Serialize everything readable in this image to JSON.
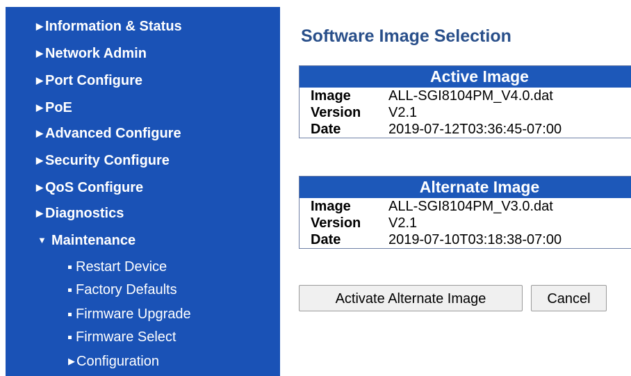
{
  "sidebar": {
    "items": [
      {
        "label": "Information & Status"
      },
      {
        "label": "Network Admin"
      },
      {
        "label": "Port Configure"
      },
      {
        "label": "PoE"
      },
      {
        "label": "Advanced Configure"
      },
      {
        "label": "Security Configure"
      },
      {
        "label": "QoS Configure"
      },
      {
        "label": "Diagnostics"
      },
      {
        "label": "Maintenance",
        "expanded": true
      }
    ],
    "maintenance_children": [
      {
        "label": "Restart Device"
      },
      {
        "label": "Factory Defaults"
      },
      {
        "label": "Firmware Upgrade"
      },
      {
        "label": "Firmware Select"
      },
      {
        "label": "Configuration"
      }
    ]
  },
  "main": {
    "title": "Software Image Selection",
    "active": {
      "heading": "Active Image",
      "image_label": "Image",
      "image_value": "ALL-SGI8104PM_V4.0.dat",
      "version_label": "Version",
      "version_value": "V2.1",
      "date_label": "Date",
      "date_value": "2019-07-12T03:36:45-07:00"
    },
    "alternate": {
      "heading": "Alternate Image",
      "image_label": "Image",
      "image_value": "ALL-SGI8104PM_V3.0.dat",
      "version_label": "Version",
      "version_value": "V2.1",
      "date_label": "Date",
      "date_value": "2019-07-10T03:18:38-07:00"
    },
    "buttons": {
      "activate": "Activate Alternate Image",
      "cancel": "Cancel"
    }
  },
  "colors": {
    "sidebar_bg": "#1a52b6",
    "table_header_bg": "#1d58b9",
    "title": "#294f8a"
  }
}
